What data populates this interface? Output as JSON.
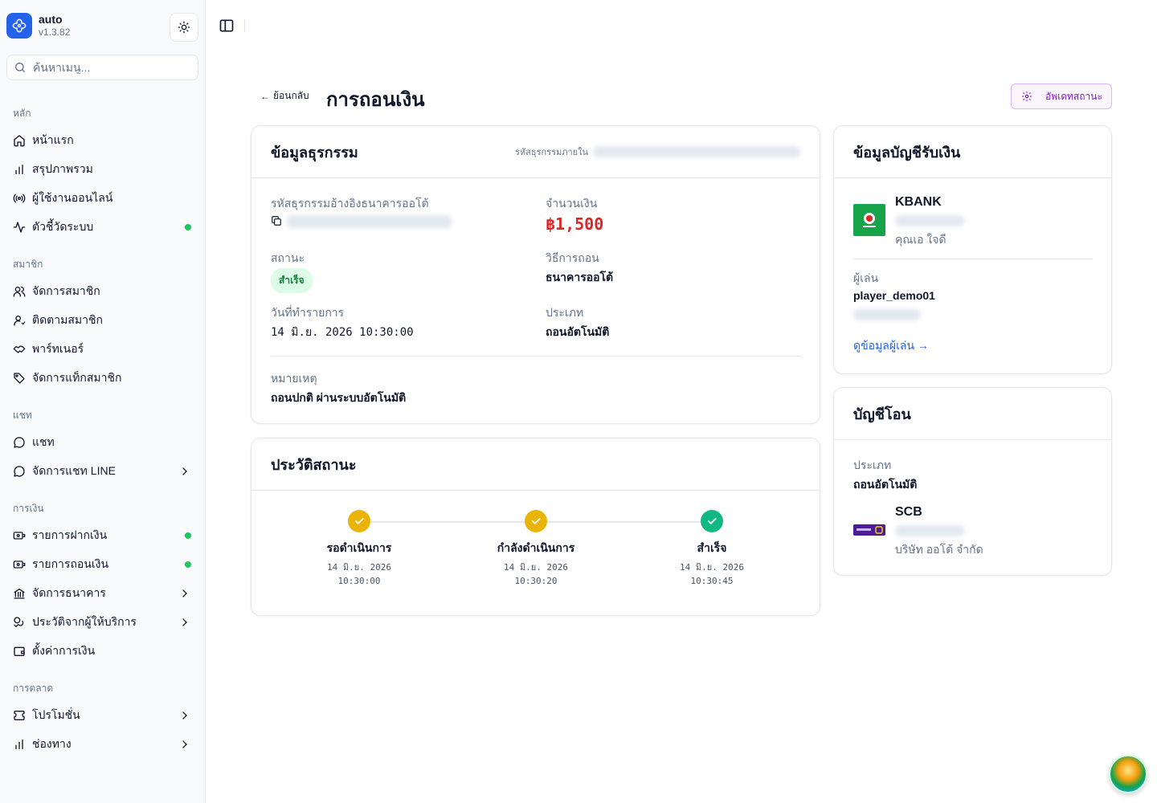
{
  "app": {
    "name": "auto",
    "version": "v1.3.82",
    "brand_color": "#2563eb"
  },
  "search": {
    "placeholder": "ค้นหาเมนู..."
  },
  "nav": {
    "groups": [
      {
        "label": "หลัก",
        "items": [
          {
            "label": "หน้าแรก",
            "icon": "home-icon"
          },
          {
            "label": "สรุปภาพรวม",
            "icon": "bar-chart-icon"
          },
          {
            "label": "ผู้ใช้งานออนไลน์",
            "icon": "broadcast-icon"
          },
          {
            "label": "ตัวชี้วัดระบบ",
            "icon": "activity-icon",
            "status_dot": true
          }
        ]
      },
      {
        "label": "สมาชิก",
        "items": [
          {
            "label": "จัดการสมาชิก",
            "icon": "users-icon"
          },
          {
            "label": "ติดตามสมาชิก",
            "icon": "user-track-icon"
          },
          {
            "label": "พาร์ทเนอร์",
            "icon": "handshake-icon"
          },
          {
            "label": "จัดการแท็กสมาชิก",
            "icon": "tag-icon"
          }
        ]
      },
      {
        "label": "แชท",
        "items": [
          {
            "label": "แชท",
            "icon": "chat-icon"
          },
          {
            "label": "จัดการแชท LINE",
            "icon": "chat-icon",
            "has_submenu": true
          }
        ]
      },
      {
        "label": "การเงิน",
        "items": [
          {
            "label": "รายการฝากเงิน",
            "icon": "money-in-icon",
            "status_dot": true
          },
          {
            "label": "รายการถอนเงิน",
            "icon": "money-out-icon",
            "status_dot": true
          },
          {
            "label": "จัดการธนาคาร",
            "icon": "bank-icon",
            "has_submenu": true
          },
          {
            "label": "ประวัติจากผู้ให้บริการ",
            "icon": "coins-icon",
            "has_submenu": true
          },
          {
            "label": "ตั้งค่าการเงิน",
            "icon": "wallet-icon"
          }
        ]
      },
      {
        "label": "การตลาด",
        "items": [
          {
            "label": "โปรโมชั่น",
            "icon": "ticket-icon",
            "has_submenu": true
          },
          {
            "label": "ช่องทาง",
            "icon": "bar-chart-icon",
            "has_submenu": true
          }
        ]
      }
    ]
  },
  "page": {
    "back_label": "ย้อนกลับ",
    "title": "การถอนเงิน",
    "update_button": "อัพเดทสถานะ"
  },
  "transaction": {
    "card_title": "ข้อมูลธุรกรรม",
    "internal_id_label": "รหัสธุรกรรมภายใน",
    "bank_ref_label": "รหัสธุรกรรมอ้างอิงธนาคารออโต้",
    "amount_label": "จำนวนเงิน",
    "amount": "฿1,500",
    "status_label": "สถานะ",
    "status": "สำเร็จ",
    "method_label": "วิธีการถอน",
    "method": "ธนาคารออโต้",
    "date_label": "วันที่ทำรายการ",
    "date": "14 มิ.ย. 2026 10:30:00",
    "type_label": "ประเภท",
    "type": "ถอนอัตโนมัติ",
    "note_label": "หมายเหตุ",
    "note": "ถอนปกติ ผ่านระบบอัตโนมัติ"
  },
  "history": {
    "card_title": "ประวัติสถานะ",
    "steps": [
      {
        "label": "รอดำเนินการ",
        "date": "14 มิ.ย. 2026",
        "time": "10:30:00",
        "color": "#eab308"
      },
      {
        "label": "กำลังดำเนินการ",
        "date": "14 มิ.ย. 2026",
        "time": "10:30:20",
        "color": "#eab308"
      },
      {
        "label": "สำเร็จ",
        "date": "14 มิ.ย. 2026",
        "time": "10:30:45",
        "color": "#10b981"
      }
    ]
  },
  "receiver": {
    "card_title": "ข้อมูลบัญชีรับเงิน",
    "bank": "KBANK",
    "holder": "คุณเอ ใจดี",
    "player_label": "ผู้เล่น",
    "player": "player_demo01",
    "player_link": "ดูข้อมูลผู้เล่น →"
  },
  "transfer": {
    "card_title": "บัญชีโอน",
    "type_label": "ประเภท",
    "type": "ถอนอัตโนมัติ",
    "bank": "SCB",
    "holder": "บริษัท ออโต้ จำกัด"
  }
}
